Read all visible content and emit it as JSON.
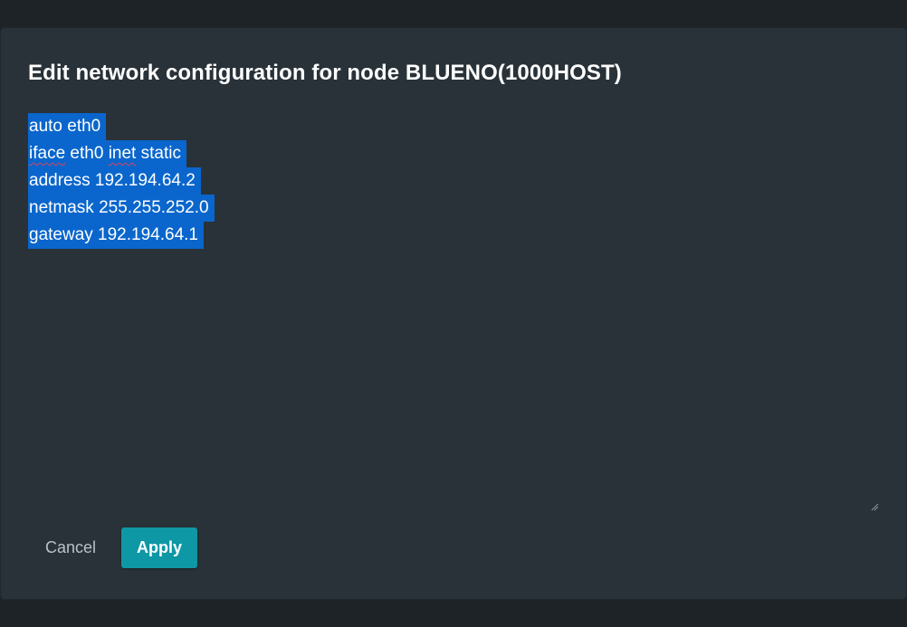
{
  "dialog": {
    "title": "Edit network configuration for node BLUENO(1000HOST)"
  },
  "config": {
    "lines": [
      [
        "auto eth0"
      ],
      [
        "iface",
        " eth0 ",
        "inet",
        " static"
      ],
      [
        "address 192.194.64.2"
      ],
      [
        "netmask 255.255.252.0"
      ],
      [
        "gateway 192.194.64.1"
      ]
    ],
    "selection_color": "#0a66cc"
  },
  "buttons": {
    "cancel_label": "Cancel",
    "apply_label": "Apply",
    "apply_color": "#0e97a5"
  },
  "icons": {
    "resize_handle": "resize-grip-icon"
  }
}
